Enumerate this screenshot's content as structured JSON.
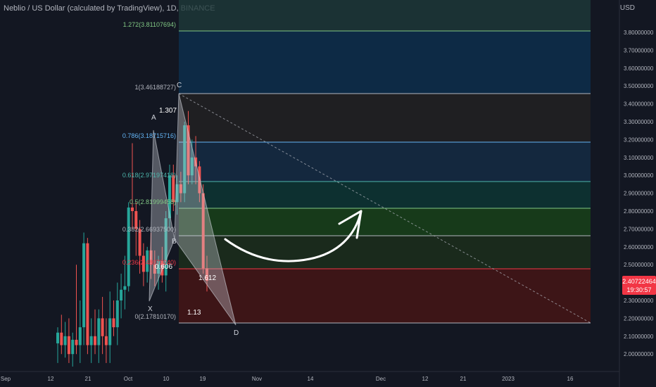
{
  "header": {
    "title": "Neblio / US Dollar (calculated by TradingView), 1D, BINANCE"
  },
  "price_axis": {
    "unit": "USD",
    "ticks": [
      "3.80000000",
      "3.70000000",
      "3.60000000",
      "3.50000000",
      "3.40000000",
      "3.30000000",
      "3.20000000",
      "3.10000000",
      "3.00000000",
      "2.90000000",
      "2.80000000",
      "2.70000000",
      "2.60000000",
      "2.50000000",
      "2.40000000",
      "2.30000000",
      "2.20000000",
      "2.10000000",
      "2.00000000"
    ],
    "current_price": "2.40722464",
    "countdown": "19:30:57",
    "current_price_color": "#f23645"
  },
  "time_axis": {
    "ticks": [
      "Sep",
      "12",
      "21",
      "Oct",
      "10",
      "19",
      "Nov",
      "14",
      "Dec",
      "12",
      "21",
      "2023",
      "16"
    ]
  },
  "fib_levels": [
    {
      "label": "1.272(3.81107694)",
      "color": "#81c784"
    },
    {
      "label": "1(3.46188727)",
      "color": "#b2b5be"
    },
    {
      "label": "0.786(3.18715716)",
      "color": "#64b5f6"
    },
    {
      "label": "0.618(2.97197418)",
      "color": "#4db6ac"
    },
    {
      "label": "0.5(2.81999458)",
      "color": "#81c784"
    },
    {
      "label": "0.382(2.66937500)",
      "color": "#b2b5be"
    },
    {
      "label": "0.236(2.48073240)",
      "color": "#f23645"
    },
    {
      "label": "0(2.17810170)",
      "color": "#b2b5be"
    }
  ],
  "pattern": {
    "points": [
      "X",
      "A",
      "B",
      "C",
      "D"
    ],
    "ratios": [
      "1.307",
      "0.606",
      "1.612",
      "1.13"
    ]
  },
  "colors": {
    "up": "#26a69a",
    "down": "#ef5350",
    "background": "#131722"
  },
  "chart_data": {
    "type": "candlestick",
    "title": "Neblio / US Dollar (calculated by TradingView), 1D, BINANCE",
    "yunit": "USD",
    "ylim": [
      1.95,
      4.0
    ],
    "current_price": 2.40722464,
    "candles": [
      {
        "o": 2.06,
        "h": 2.15,
        "l": 1.95,
        "c": 2.12
      },
      {
        "o": 2.12,
        "h": 2.22,
        "l": 2.0,
        "c": 2.05
      },
      {
        "o": 2.05,
        "h": 2.18,
        "l": 1.98,
        "c": 2.1
      },
      {
        "o": 2.1,
        "h": 2.2,
        "l": 1.95,
        "c": 2.0
      },
      {
        "o": 2.0,
        "h": 2.12,
        "l": 1.93,
        "c": 2.08
      },
      {
        "o": 2.08,
        "h": 2.5,
        "l": 2.0,
        "c": 2.05
      },
      {
        "o": 2.05,
        "h": 2.3,
        "l": 1.95,
        "c": 2.15
      },
      {
        "o": 2.15,
        "h": 2.68,
        "l": 2.05,
        "c": 2.62
      },
      {
        "o": 2.62,
        "h": 2.65,
        "l": 2.0,
        "c": 2.05
      },
      {
        "o": 2.05,
        "h": 2.2,
        "l": 1.95,
        "c": 2.1
      },
      {
        "o": 2.1,
        "h": 2.25,
        "l": 2.0,
        "c": 2.05
      },
      {
        "o": 2.05,
        "h": 2.25,
        "l": 1.95,
        "c": 2.2
      },
      {
        "o": 2.2,
        "h": 2.32,
        "l": 2.0,
        "c": 2.1
      },
      {
        "o": 2.1,
        "h": 2.2,
        "l": 1.95,
        "c": 2.05
      },
      {
        "o": 2.05,
        "h": 2.35,
        "l": 1.95,
        "c": 2.2
      },
      {
        "o": 2.2,
        "h": 2.3,
        "l": 2.1,
        "c": 2.15
      },
      {
        "o": 2.15,
        "h": 2.4,
        "l": 2.05,
        "c": 2.3
      },
      {
        "o": 2.3,
        "h": 2.45,
        "l": 2.2,
        "c": 2.36
      },
      {
        "o": 2.36,
        "h": 2.55,
        "l": 2.25,
        "c": 2.38
      },
      {
        "o": 2.38,
        "h": 2.85,
        "l": 2.35,
        "c": 2.82
      },
      {
        "o": 2.82,
        "h": 3.18,
        "l": 2.7,
        "c": 2.8
      },
      {
        "o": 2.8,
        "h": 2.85,
        "l": 2.55,
        "c": 2.7
      },
      {
        "o": 2.7,
        "h": 2.75,
        "l": 2.45,
        "c": 2.55
      },
      {
        "o": 2.55,
        "h": 2.62,
        "l": 2.38,
        "c": 2.46
      },
      {
        "o": 2.46,
        "h": 2.6,
        "l": 2.4,
        "c": 2.58
      },
      {
        "o": 2.58,
        "h": 2.68,
        "l": 2.42,
        "c": 2.5
      },
      {
        "o": 2.5,
        "h": 2.58,
        "l": 2.38,
        "c": 2.45
      },
      {
        "o": 2.45,
        "h": 2.55,
        "l": 2.36,
        "c": 2.52
      },
      {
        "o": 2.52,
        "h": 2.6,
        "l": 2.4,
        "c": 2.44
      },
      {
        "o": 2.44,
        "h": 2.8,
        "l": 2.35,
        "c": 2.76
      },
      {
        "o": 2.76,
        "h": 3.06,
        "l": 2.7,
        "c": 3.0
      },
      {
        "o": 3.0,
        "h": 3.06,
        "l": 2.8,
        "c": 2.85
      },
      {
        "o": 2.85,
        "h": 3.0,
        "l": 2.78,
        "c": 2.95
      },
      {
        "o": 2.95,
        "h": 3.02,
        "l": 2.85,
        "c": 2.9
      },
      {
        "o": 2.9,
        "h": 3.3,
        "l": 2.85,
        "c": 3.28
      },
      {
        "o": 3.28,
        "h": 3.36,
        "l": 2.95,
        "c": 3.0
      },
      {
        "o": 3.0,
        "h": 3.2,
        "l": 2.95,
        "c": 3.1
      },
      {
        "o": 3.1,
        "h": 3.22,
        "l": 2.95,
        "c": 3.05
      },
      {
        "o": 3.05,
        "h": 3.08,
        "l": 2.85,
        "c": 2.9
      },
      {
        "o": 2.9,
        "h": 2.95,
        "l": 2.45,
        "c": 2.48
      },
      {
        "o": 2.48,
        "h": 2.55,
        "l": 2.35,
        "c": 2.41
      }
    ]
  }
}
